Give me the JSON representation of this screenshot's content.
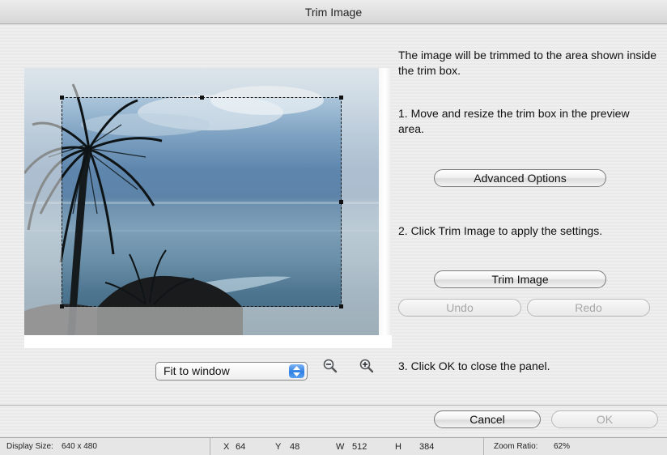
{
  "window": {
    "title": "Trim Image"
  },
  "instructions": {
    "intro": "The image will be trimmed to the area shown inside the trim box.",
    "step1": "1.  Move and resize the trim box in the preview area.",
    "step2": "2. Click Trim Image to apply the settings.",
    "step3": "3. Click OK to close the panel."
  },
  "buttons": {
    "advanced_options": "Advanced Options",
    "trim_image": "Trim Image",
    "undo": "Undo",
    "redo": "Redo",
    "cancel": "Cancel",
    "ok": "OK"
  },
  "zoom": {
    "selected": "Fit to window",
    "zoom_out_icon": "zoom-out-icon",
    "zoom_in_icon": "zoom-in-icon"
  },
  "status": {
    "display_size_label": "Display Size:",
    "display_size_value": "640 x 480",
    "x_label": "X",
    "x_value": "64",
    "y_label": "Y",
    "y_value": "48",
    "w_label": "W",
    "w_value": "512",
    "h_label": "H",
    "h_value": "384",
    "zoom_ratio_label": "Zoom Ratio:",
    "zoom_ratio_value": "62%"
  }
}
